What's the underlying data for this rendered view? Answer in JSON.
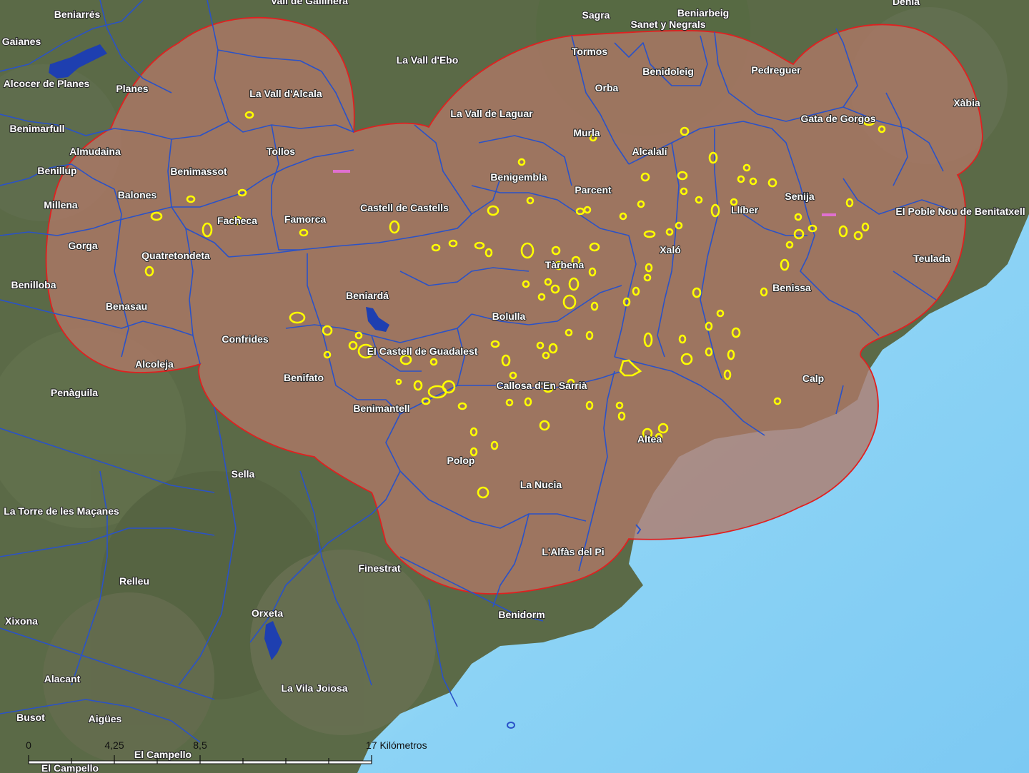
{
  "places": [
    {
      "id": "val-de-gallinera",
      "name": "Vall de Gallinera"
    },
    {
      "id": "beniarres",
      "name": "Beniarrés"
    },
    {
      "id": "sagra",
      "name": "Sagra"
    },
    {
      "id": "beniarbeig",
      "name": "Beniarbeig"
    },
    {
      "id": "sanet-y-negrals",
      "name": "Sanet y Negrals"
    },
    {
      "id": "denia",
      "name": "Dénia"
    },
    {
      "id": "gaianes",
      "name": "Gaianes"
    },
    {
      "id": "tormos",
      "name": "Tormos"
    },
    {
      "id": "la-vall-debo",
      "name": "La Vall d'Ebo"
    },
    {
      "id": "benidoleig",
      "name": "Benidoleig"
    },
    {
      "id": "pedreguer",
      "name": "Pedreguer"
    },
    {
      "id": "alcocer-de-planes",
      "name": "Alcocer de Planes"
    },
    {
      "id": "planes",
      "name": "Planes"
    },
    {
      "id": "orba",
      "name": "Orba"
    },
    {
      "id": "la-vall-dalcala",
      "name": "La Vall d'Alcala"
    },
    {
      "id": "xabia",
      "name": "Xàbia"
    },
    {
      "id": "la-vall-de-laguar",
      "name": "La Vall de Laguar"
    },
    {
      "id": "gata-de-gorgos",
      "name": "Gata de Gorgos"
    },
    {
      "id": "benimarfull",
      "name": "Benimarfull"
    },
    {
      "id": "murla",
      "name": "Murla"
    },
    {
      "id": "almudaina",
      "name": "Almudaina"
    },
    {
      "id": "tollos",
      "name": "Tollos"
    },
    {
      "id": "alcalali",
      "name": "Alcalalí"
    },
    {
      "id": "benillup",
      "name": "Benillup"
    },
    {
      "id": "benimassot",
      "name": "Benimassot"
    },
    {
      "id": "benigembla",
      "name": "Benigembla"
    },
    {
      "id": "parcent",
      "name": "Parcent"
    },
    {
      "id": "balones",
      "name": "Balones"
    },
    {
      "id": "senija",
      "name": "Senija"
    },
    {
      "id": "millena",
      "name": "Millena"
    },
    {
      "id": "castell-de-castells",
      "name": "Castell de Castells"
    },
    {
      "id": "lliber",
      "name": "Llíber"
    },
    {
      "id": "el-poble-nou",
      "name": "El Poble Nou de Benitatxell"
    },
    {
      "id": "facheca",
      "name": "Facheca"
    },
    {
      "id": "famorca",
      "name": "Famorca"
    },
    {
      "id": "gorga",
      "name": "Gorga"
    },
    {
      "id": "xalo",
      "name": "Xaló"
    },
    {
      "id": "quatretondeta",
      "name": "Quatretondeta"
    },
    {
      "id": "teulada",
      "name": "Teulada"
    },
    {
      "id": "tarbena",
      "name": "Tàrbena"
    },
    {
      "id": "benilloba",
      "name": "Benilloba"
    },
    {
      "id": "benissa",
      "name": "Benissa"
    },
    {
      "id": "beniarda",
      "name": "Beniardá"
    },
    {
      "id": "benasau",
      "name": "Benasau"
    },
    {
      "id": "bolulla",
      "name": "Bolulla"
    },
    {
      "id": "confrides",
      "name": "Confrides"
    },
    {
      "id": "el-castell-de-guadalest",
      "name": "El Castell de Guadalest"
    },
    {
      "id": "alcoleja",
      "name": "Alcoleja"
    },
    {
      "id": "benifato",
      "name": "Benifato"
    },
    {
      "id": "calp",
      "name": "Calp"
    },
    {
      "id": "callosa",
      "name": "Callosa d'En Sarrià"
    },
    {
      "id": "penaguila",
      "name": "Penàguila"
    },
    {
      "id": "benimantell",
      "name": "Benimantell"
    },
    {
      "id": "altea",
      "name": "Altea"
    },
    {
      "id": "polop",
      "name": "Polop"
    },
    {
      "id": "sella",
      "name": "Sella"
    },
    {
      "id": "la-nucia",
      "name": "La Nucia"
    },
    {
      "id": "la-torre-de-les-macanes",
      "name": "La Torre de les Maçanes"
    },
    {
      "id": "lalfas-del-pi",
      "name": "L'Alfàs del Pi"
    },
    {
      "id": "finestrat",
      "name": "Finestrat"
    },
    {
      "id": "relleu",
      "name": "Relleu"
    },
    {
      "id": "orxeta",
      "name": "Orxeta"
    },
    {
      "id": "benidorm",
      "name": "Benidorm"
    },
    {
      "id": "xixona",
      "name": "Xixona"
    },
    {
      "id": "alacant",
      "name": "Alacant"
    },
    {
      "id": "la-vila-joiosa",
      "name": "La Vila Joiosa"
    },
    {
      "id": "busot",
      "name": "Busot"
    },
    {
      "id": "aigues",
      "name": "Aigües"
    },
    {
      "id": "el-campello-1",
      "name": "El Campello"
    },
    {
      "id": "el-campello-2",
      "name": "El Campello"
    }
  ],
  "scale_bar": {
    "ticks": [
      "0",
      "4,25",
      "8,5",
      "17 Kilómetros"
    ]
  },
  "colors": {
    "land": "#5b6a47",
    "sea": "#8cd3f5",
    "study_area_fill": "#b07868",
    "study_area_outline": "#e02020",
    "municipal_boundary": "#2a52c8",
    "reservoir": "#1e3fb0",
    "highlighted_sites": "#ffff00"
  }
}
